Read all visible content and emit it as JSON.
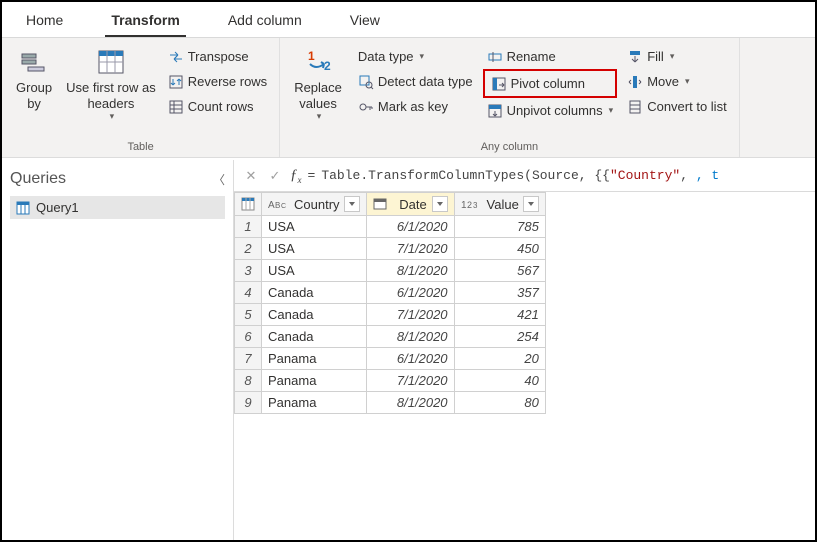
{
  "tabs": [
    "Home",
    "Transform",
    "Add column",
    "View"
  ],
  "active_tab_index": 1,
  "ribbon": {
    "groups": {
      "table": {
        "label": "Table",
        "group_by": "Group\nby",
        "first_row_headers": "Use first row as\nheaders",
        "transpose": "Transpose",
        "reverse": "Reverse rows",
        "count": "Count rows"
      },
      "any_column": {
        "label": "Any column",
        "replace": "Replace\nvalues",
        "data_type": "Data type",
        "detect": "Detect data type",
        "mark_key": "Mark as key",
        "rename": "Rename",
        "pivot": "Pivot column",
        "unpivot": "Unpivot columns",
        "fill": "Fill",
        "move": "Move",
        "convert": "Convert to list"
      }
    }
  },
  "queries": {
    "title": "Queries",
    "items": [
      "Query1"
    ]
  },
  "formula": {
    "prefix": "Table.TransformColumnTypes(Source, {{",
    "str": "\"Country\"",
    "tail": ", t"
  },
  "columns": [
    {
      "name": "Country",
      "type": "text"
    },
    {
      "name": "Date",
      "type": "date",
      "selected": true
    },
    {
      "name": "Value",
      "type": "number"
    }
  ],
  "chart_data": {
    "type": "table",
    "columns": [
      "Country",
      "Date",
      "Value"
    ],
    "rows": [
      [
        "USA",
        "6/1/2020",
        785
      ],
      [
        "USA",
        "7/1/2020",
        450
      ],
      [
        "USA",
        "8/1/2020",
        567
      ],
      [
        "Canada",
        "6/1/2020",
        357
      ],
      [
        "Canada",
        "7/1/2020",
        421
      ],
      [
        "Canada",
        "8/1/2020",
        254
      ],
      [
        "Panama",
        "6/1/2020",
        20
      ],
      [
        "Panama",
        "7/1/2020",
        40
      ],
      [
        "Panama",
        "8/1/2020",
        80
      ]
    ]
  }
}
